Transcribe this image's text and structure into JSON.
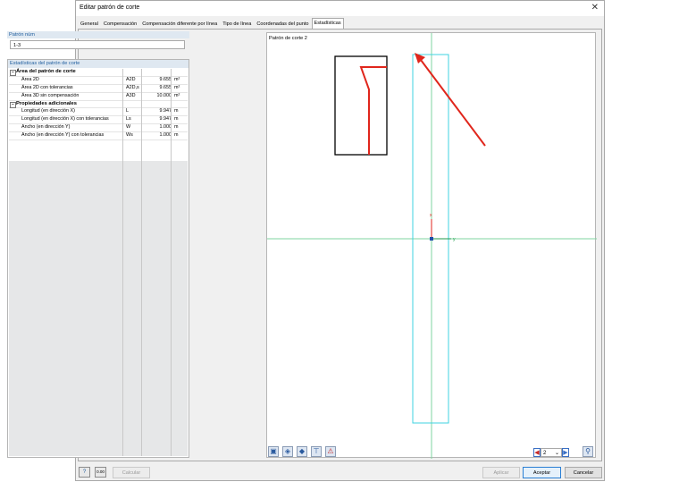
{
  "window": {
    "title": "Editar patrón de corte",
    "close_glyph": "✕"
  },
  "tabs": [
    {
      "label": "General"
    },
    {
      "label": "Compensación"
    },
    {
      "label": "Compensación diferente por línea"
    },
    {
      "label": "Tipo de línea"
    },
    {
      "label": "Coordenadas del punto"
    },
    {
      "label": "Estadísticas",
      "active": true
    }
  ],
  "pattern": {
    "section_label": "Patrón núm",
    "value": "1-3"
  },
  "stats": {
    "title": "Estadísticas del patrón de corte",
    "groups": [
      {
        "label": "Área del patrón de corte",
        "rows": [
          {
            "name": "Área 2D",
            "symbol": "A2D",
            "value": "9.655",
            "unit": "m²"
          },
          {
            "name": "Área 2D con tolerancias",
            "symbol": "A2D,s",
            "value": "9.655",
            "unit": "m²"
          },
          {
            "name": "Área 3D sin compensación",
            "symbol": "A3D",
            "value": "10.000",
            "unit": "m²"
          }
        ]
      },
      {
        "label": "Propiedades adicionales",
        "rows": [
          {
            "name": "Longitud (en dirección X)",
            "symbol": "L",
            "value": "9.947",
            "unit": "m"
          },
          {
            "name": "Longitud (en dirección X) con tolerancias",
            "symbol": "Ls",
            "value": "9.947",
            "unit": "m"
          },
          {
            "name": "Ancho (en dirección Y)",
            "symbol": "W",
            "value": "1.000",
            "unit": "m"
          },
          {
            "name": "Ancho (en dirección Y) con tolerancias",
            "symbol": "Ws",
            "value": "1.000",
            "unit": "m"
          }
        ]
      }
    ]
  },
  "canvas": {
    "label": "Patrón de corte 2",
    "axis_x_label": "x",
    "axis_y_label": "y",
    "colors": {
      "pattern": "#3fd3e0",
      "axis": "#7fd6a0",
      "arrow": "#e0261c",
      "x_axis": "#e0261c",
      "y_axis": "#1d9a4a"
    }
  },
  "canvas_tools": [
    "view-front-icon",
    "view-iso-icon",
    "view-surface-icon",
    "dimension-icon",
    "warning-icon"
  ],
  "stepper": {
    "value": "2",
    "prev": "◀",
    "next": "▶"
  },
  "buttons": {
    "help": "?",
    "units": "0.00",
    "calculate": "Calcular",
    "apply": "Aplicar",
    "accept": "Aceptar",
    "cancel": "Cancelar"
  }
}
